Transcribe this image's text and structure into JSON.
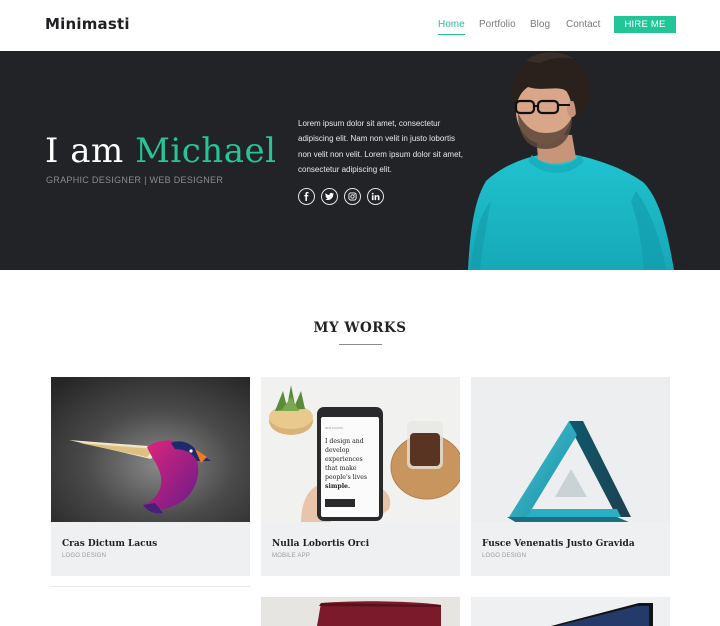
{
  "brand": "Minimasti",
  "nav": {
    "items": [
      "Home",
      "Portfolio",
      "Blog",
      "Contact"
    ],
    "active": "Home",
    "cta": "HIRE ME"
  },
  "hero": {
    "title_prefix": "I am",
    "title_name": "Michael",
    "subtitle": "GRAPHIC DESIGNER | WEB DESIGNER",
    "paragraph": "Lorem ipsum dolor sit amet, consectetur adipiscing elit. Nam non velit in justo lobortis non velit non velit. Lorem ipsum dolor sit amet, consectetur adipiscing elit.",
    "socials": [
      "facebook",
      "twitter",
      "instagram",
      "linkedin"
    ]
  },
  "works": {
    "title": "MY WORKS",
    "items": [
      {
        "title": "Cras Dictum Lacus",
        "category": "LOGO DESIGN"
      },
      {
        "title": "Nulla Lobortis Orci",
        "category": "MOBILE APP"
      },
      {
        "title": "Fusce Venenatis Justo Gravida",
        "category": "LOGO DESIGN"
      }
    ],
    "phone_screen_text": "I design and develop experiences that make people's lives simple."
  },
  "colors": {
    "accent": "#26c497",
    "hero_bg": "#222326",
    "shirt": "#1fb7c6"
  }
}
